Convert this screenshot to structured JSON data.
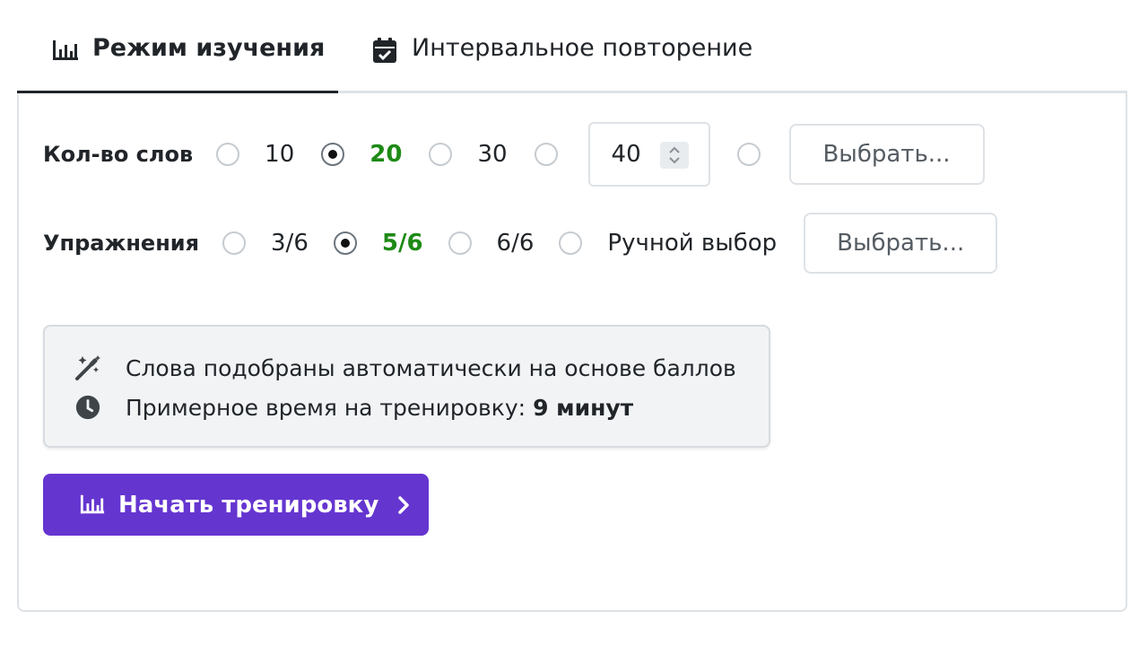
{
  "tabs": [
    {
      "label": "Режим изучения",
      "icon": "bar-chart-icon",
      "active": true
    },
    {
      "label": "Интервальное повторение",
      "icon": "calendar-check-icon",
      "active": false
    }
  ],
  "word_count": {
    "label": "Кол-во слов",
    "options": [
      "10",
      "20",
      "30"
    ],
    "selected": "20",
    "custom_value": "40",
    "choose_button": "Выбрать..."
  },
  "exercises": {
    "label": "Упражнения",
    "options": [
      "3/6",
      "5/6",
      "6/6",
      "Ручной выбор"
    ],
    "selected": "5/6",
    "choose_button": "Выбрать..."
  },
  "info": {
    "auto_text": "Слова подобраны автоматически на основе баллов",
    "time_text": "Примерное время на тренировку:",
    "time_value": "9 минут",
    "auto_icon": "magic-wand-icon",
    "time_icon": "clock-icon"
  },
  "start_button": {
    "label": "Начать тренировку",
    "icon": "bar-chart-icon"
  },
  "colors": {
    "accent": "#6535d0",
    "selected_text": "#1e8a16"
  }
}
